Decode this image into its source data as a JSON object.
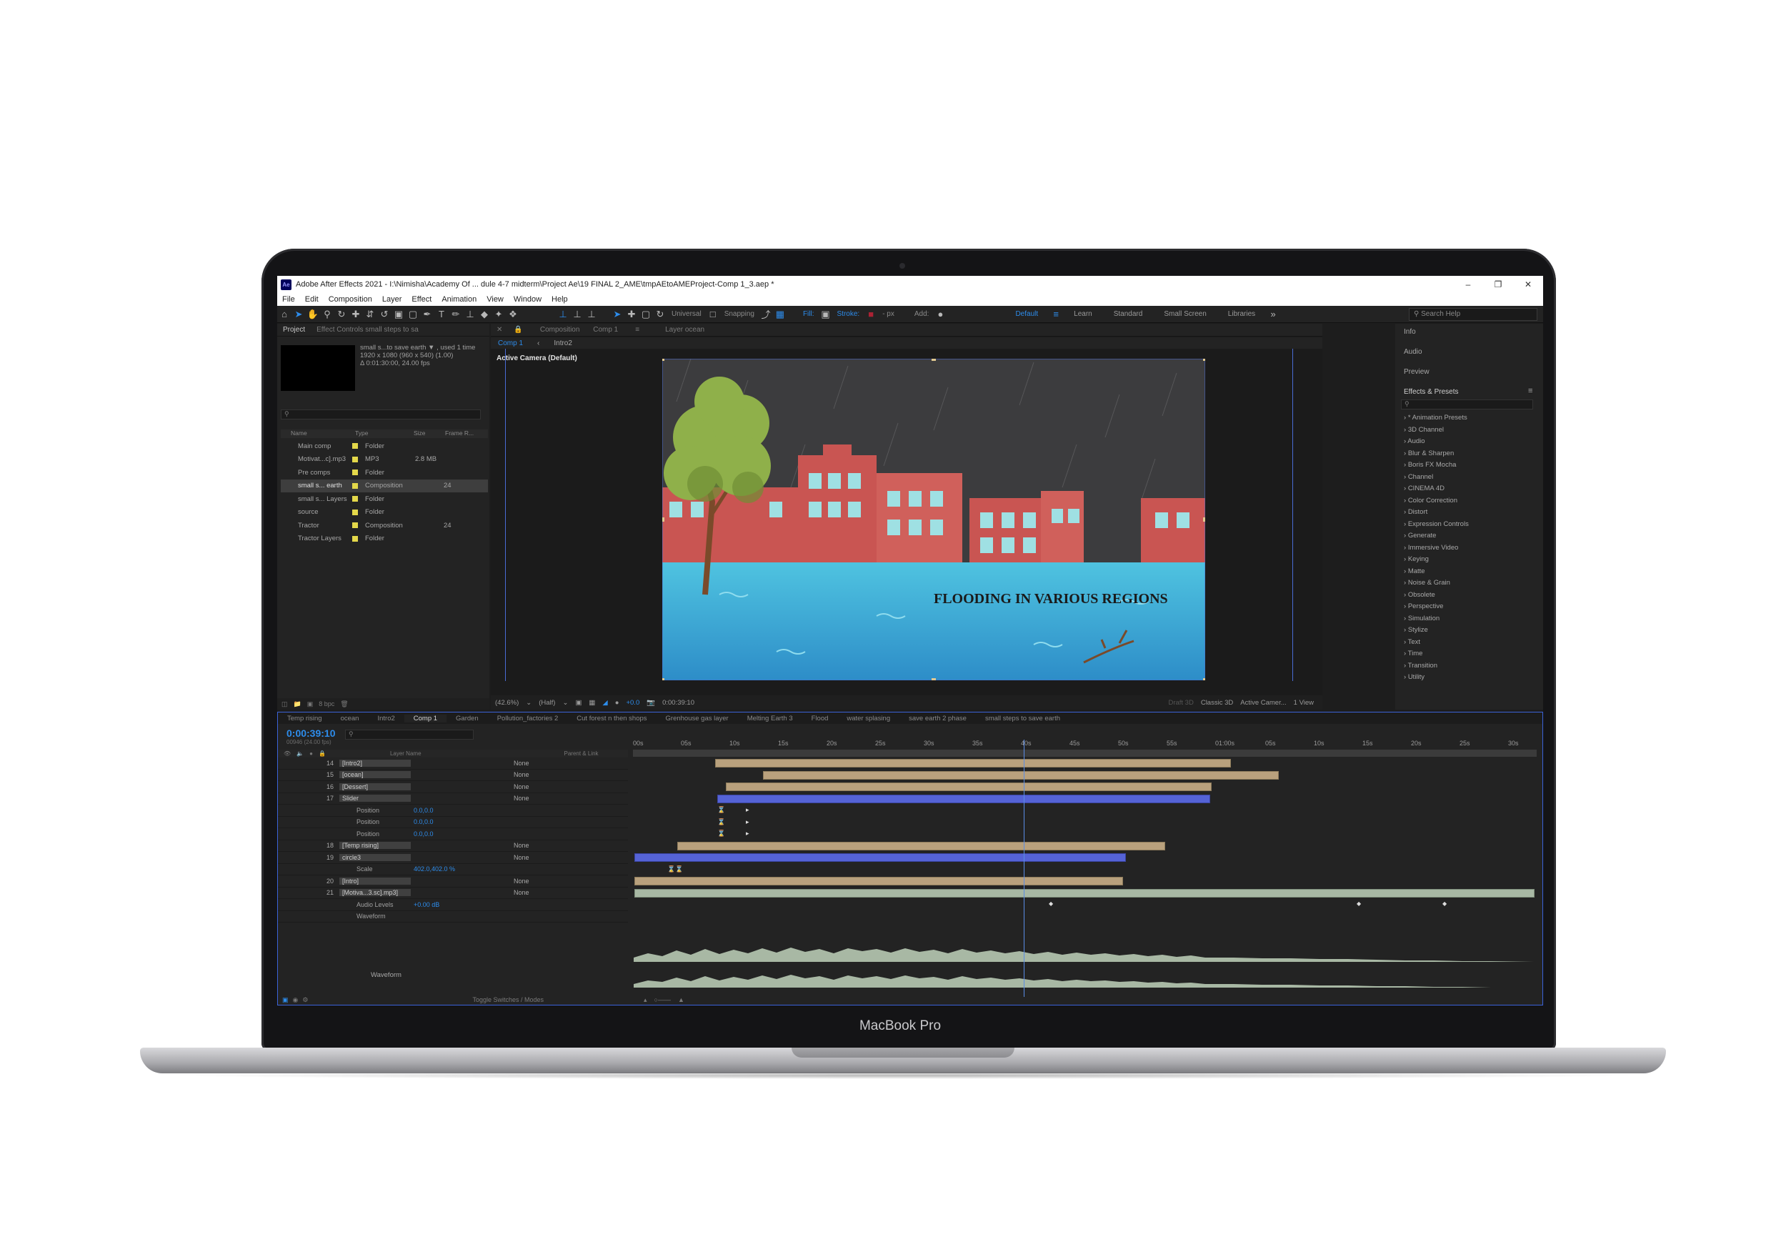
{
  "device": {
    "label": "MacBook Pro"
  },
  "window": {
    "title": "Adobe After Effects 2021 - I:\\Nimisha\\Academy Of ... dule 4-7 midterm\\Project Ae\\19 FINAL 2_AME\\tmpAEtoAMEProject-Comp 1_3.aep *",
    "app_icon": "Ae"
  },
  "menu": [
    "File",
    "Edit",
    "Composition",
    "Layer",
    "Effect",
    "Animation",
    "View",
    "Window",
    "Help"
  ],
  "toolbar": {
    "universal": "Universal",
    "snapping": "Snapping",
    "fill": "Fill:",
    "stroke": "Stroke:",
    "px": "- px",
    "add": "Add:",
    "workspaces": [
      "Default",
      "Learn",
      "Standard",
      "Small Screen",
      "Libraries"
    ],
    "active_workspace": "Default",
    "search_placeholder": "Search Help"
  },
  "project": {
    "tab": "Project",
    "tab2": "Effect Controls small steps to sa",
    "selected_name": "small s...to save earth ▼ , used 1 time",
    "selected_res": "1920 x 1080 (960 x 540) (1.00)",
    "selected_dur": "Δ 0:01:30:00, 24.00 fps",
    "columns": [
      "Name",
      "Type",
      "Size",
      "Frame R..."
    ],
    "items": [
      {
        "name": "Main comp",
        "type": "Folder",
        "size": "",
        "fr": ""
      },
      {
        "name": "Motivat...c].mp3",
        "type": "MP3",
        "size": "2.8 MB",
        "fr": ""
      },
      {
        "name": "Pre comps",
        "type": "Folder",
        "size": "",
        "fr": ""
      },
      {
        "name": "small s... earth",
        "type": "Composition",
        "size": "",
        "fr": "24"
      },
      {
        "name": "small s... Layers",
        "type": "Folder",
        "size": "",
        "fr": ""
      },
      {
        "name": "source",
        "type": "Folder",
        "size": "",
        "fr": ""
      },
      {
        "name": "Tractor",
        "type": "Composition",
        "size": "",
        "fr": "24"
      },
      {
        "name": "Tractor Layers",
        "type": "Folder",
        "size": "",
        "fr": ""
      }
    ],
    "bpc": "8 bpc"
  },
  "composition": {
    "tab": "Composition",
    "tab_comp": "Comp 1",
    "layer_tab": "Layer ocean",
    "sub_tabs": [
      "Comp 1",
      "Intro2"
    ],
    "camera": "Active Camera (Default)",
    "caption": "FLOODING IN VARIOUS REGIONS",
    "zoom": "(42.6%)",
    "quality": "(Half)",
    "exposure": "+0.0",
    "timecode": "0:00:39:10",
    "draft": "Draft 3D",
    "renderer": "Classic 3D",
    "camera_view": "Active Camer...",
    "views": "1 View"
  },
  "right_panel": {
    "info": "Info",
    "audio": "Audio",
    "preview": "Preview",
    "effects_title": "Effects & Presets",
    "effects": [
      "* Animation Presets",
      "3D Channel",
      "Audio",
      "Blur & Sharpen",
      "Boris FX Mocha",
      "Channel",
      "CINEMA 4D",
      "Color Correction",
      "Distort",
      "Expression Controls",
      "Generate",
      "Immersive Video",
      "Keying",
      "Matte",
      "Noise & Grain",
      "Obsolete",
      "Perspective",
      "Simulation",
      "Stylize",
      "Text",
      "Time",
      "Transition",
      "Utility"
    ]
  },
  "timeline": {
    "tabs": [
      "Temp rising",
      "ocean",
      "Intro2",
      "Comp 1",
      "Garden",
      "Pollution_factories 2",
      "Cut forest n then shops",
      "Grenhouse gas layer",
      "Melting Earth 3",
      "Flood",
      "water splasing",
      "save earth 2 phase",
      "small steps to save earth"
    ],
    "active_tab": "Comp 1",
    "timecode": "0:00:39:10",
    "timecode_sub": "00946 (24.00 fps)",
    "col_layer": "Layer Name",
    "col_parent": "Parent & Link",
    "ruler": [
      "00s",
      "05s",
      "10s",
      "15s",
      "20s",
      "25s",
      "30s",
      "35s",
      "40s",
      "45s",
      "50s",
      "55s",
      "01:00s",
      "05s",
      "10s",
      "15s",
      "20s",
      "25s",
      "30s"
    ],
    "layers": [
      {
        "num": "14",
        "name": "[Intro2]",
        "kind": "layer",
        "val": "",
        "parent": "None"
      },
      {
        "num": "15",
        "name": "[ocean]",
        "kind": "layer",
        "val": "",
        "parent": "None"
      },
      {
        "num": "16",
        "name": "[Dessert]",
        "kind": "layer",
        "val": "",
        "parent": "None"
      },
      {
        "num": "17",
        "name": "Slider",
        "kind": "layer",
        "val": "",
        "parent": "None"
      },
      {
        "num": "",
        "name": "Position",
        "kind": "prop",
        "val": "0.0,0.0",
        "parent": ""
      },
      {
        "num": "",
        "name": "Position",
        "kind": "prop",
        "val": "0.0,0.0",
        "parent": ""
      },
      {
        "num": "",
        "name": "Position",
        "kind": "prop",
        "val": "0.0,0.0",
        "parent": ""
      },
      {
        "num": "18",
        "name": "[Temp rising]",
        "kind": "layer",
        "val": "",
        "parent": "None"
      },
      {
        "num": "19",
        "name": "circle3",
        "kind": "layer",
        "val": "",
        "parent": "None"
      },
      {
        "num": "",
        "name": "Scale",
        "kind": "prop",
        "val": "402.0,402.0 %",
        "parent": ""
      },
      {
        "num": "20",
        "name": "[Intro]",
        "kind": "layer",
        "val": "",
        "parent": "None"
      },
      {
        "num": "21",
        "name": "[Motiva...3.sc].mp3]",
        "kind": "layer",
        "val": "",
        "parent": "None"
      },
      {
        "num": "",
        "name": "Audio Levels",
        "kind": "prop",
        "val": "+0.00 dB",
        "parent": ""
      },
      {
        "num": "",
        "name": "Waveform",
        "kind": "prop",
        "val": "",
        "parent": ""
      }
    ],
    "waveform_label": "Waveform",
    "toggle": "Toggle Switches / Modes"
  },
  "colors": {
    "accent": "#2d8ceb",
    "bar_tan": "#b9a17d",
    "bar_blue": "#5563d6",
    "audio_bar": "#a8b8a4"
  }
}
